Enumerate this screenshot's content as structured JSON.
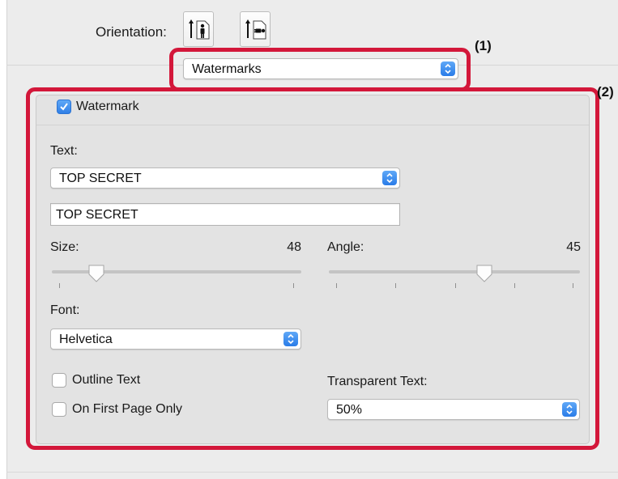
{
  "orientation": {
    "label": "Orientation:",
    "options": [
      "portrait-icon",
      "landscape-icon"
    ]
  },
  "panel_select": {
    "value": "Watermarks"
  },
  "callouts": {
    "one": "(1)",
    "two": "(2)"
  },
  "watermark": {
    "enable_label": "Watermark",
    "enabled": true,
    "text_label": "Text:",
    "text_preset": "TOP SECRET",
    "text_value": "TOP SECRET",
    "size": {
      "label": "Size:",
      "value": "48",
      "level": 0.18
    },
    "angle": {
      "label": "Angle:",
      "value": "45",
      "level": 0.62
    },
    "font_label": "Font:",
    "font_value": "Helvetica",
    "outline_label": "Outline Text",
    "outline_checked": false,
    "first_page_label": "On First Page Only",
    "first_page_checked": false,
    "transparent_label": "Transparent Text:",
    "transparent_value": "50%"
  },
  "colors": {
    "callout": "#d3173a",
    "accent": "#2f7fe6"
  }
}
